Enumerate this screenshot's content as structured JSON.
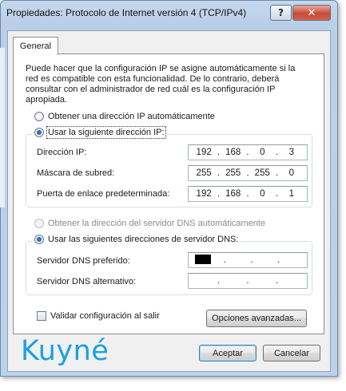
{
  "window": {
    "title": "Propiedades: Protocolo de Internet versión 4 (TCP/IPv4)",
    "help_glyph": "?",
    "close_glyph": "✕"
  },
  "tabs": [
    {
      "label": "General",
      "selected": true
    }
  ],
  "description": "Puede hacer que la configuración IP se asigne automáticamente si la red es compatible con esta funcionalidad. De lo contrario, deberá consultar con el administrador de red cuál es la configuración IP apropiada.",
  "ip": {
    "auto_label": "Obtener una dirección IP automáticamente",
    "manual_label": "Usar la siguiente dirección IP:",
    "mode": "manual",
    "address_label": "Dirección IP:",
    "address": [
      "192",
      "168",
      "0",
      "3"
    ],
    "subnet_label": "Máscara de subred:",
    "subnet": [
      "255",
      "255",
      "255",
      "0"
    ],
    "gateway_label": "Puerta de enlace predeterminada:",
    "gateway": [
      "192",
      "168",
      "0",
      "1"
    ]
  },
  "dns": {
    "auto_label": "Obtener la dirección del servidor DNS automáticamente",
    "manual_label": "Usar las siguientes direcciones de servidor DNS:",
    "mode": "manual",
    "preferred_label": "Servidor DNS preferido:",
    "preferred": [
      "",
      "",
      "",
      ""
    ],
    "alternate_label": "Servidor DNS alternativo:",
    "alternate": [
      "",
      "",
      "",
      ""
    ]
  },
  "validate_label": "Validar configuración al salir",
  "validate_checked": false,
  "advanced_button": "Opciones avanzadas...",
  "ok_button": "Aceptar",
  "cancel_button": "Cancelar",
  "watermark": "Kuyné",
  "colors": {
    "watermark": "#1aa1e0",
    "close_button": "#c74b3a"
  }
}
